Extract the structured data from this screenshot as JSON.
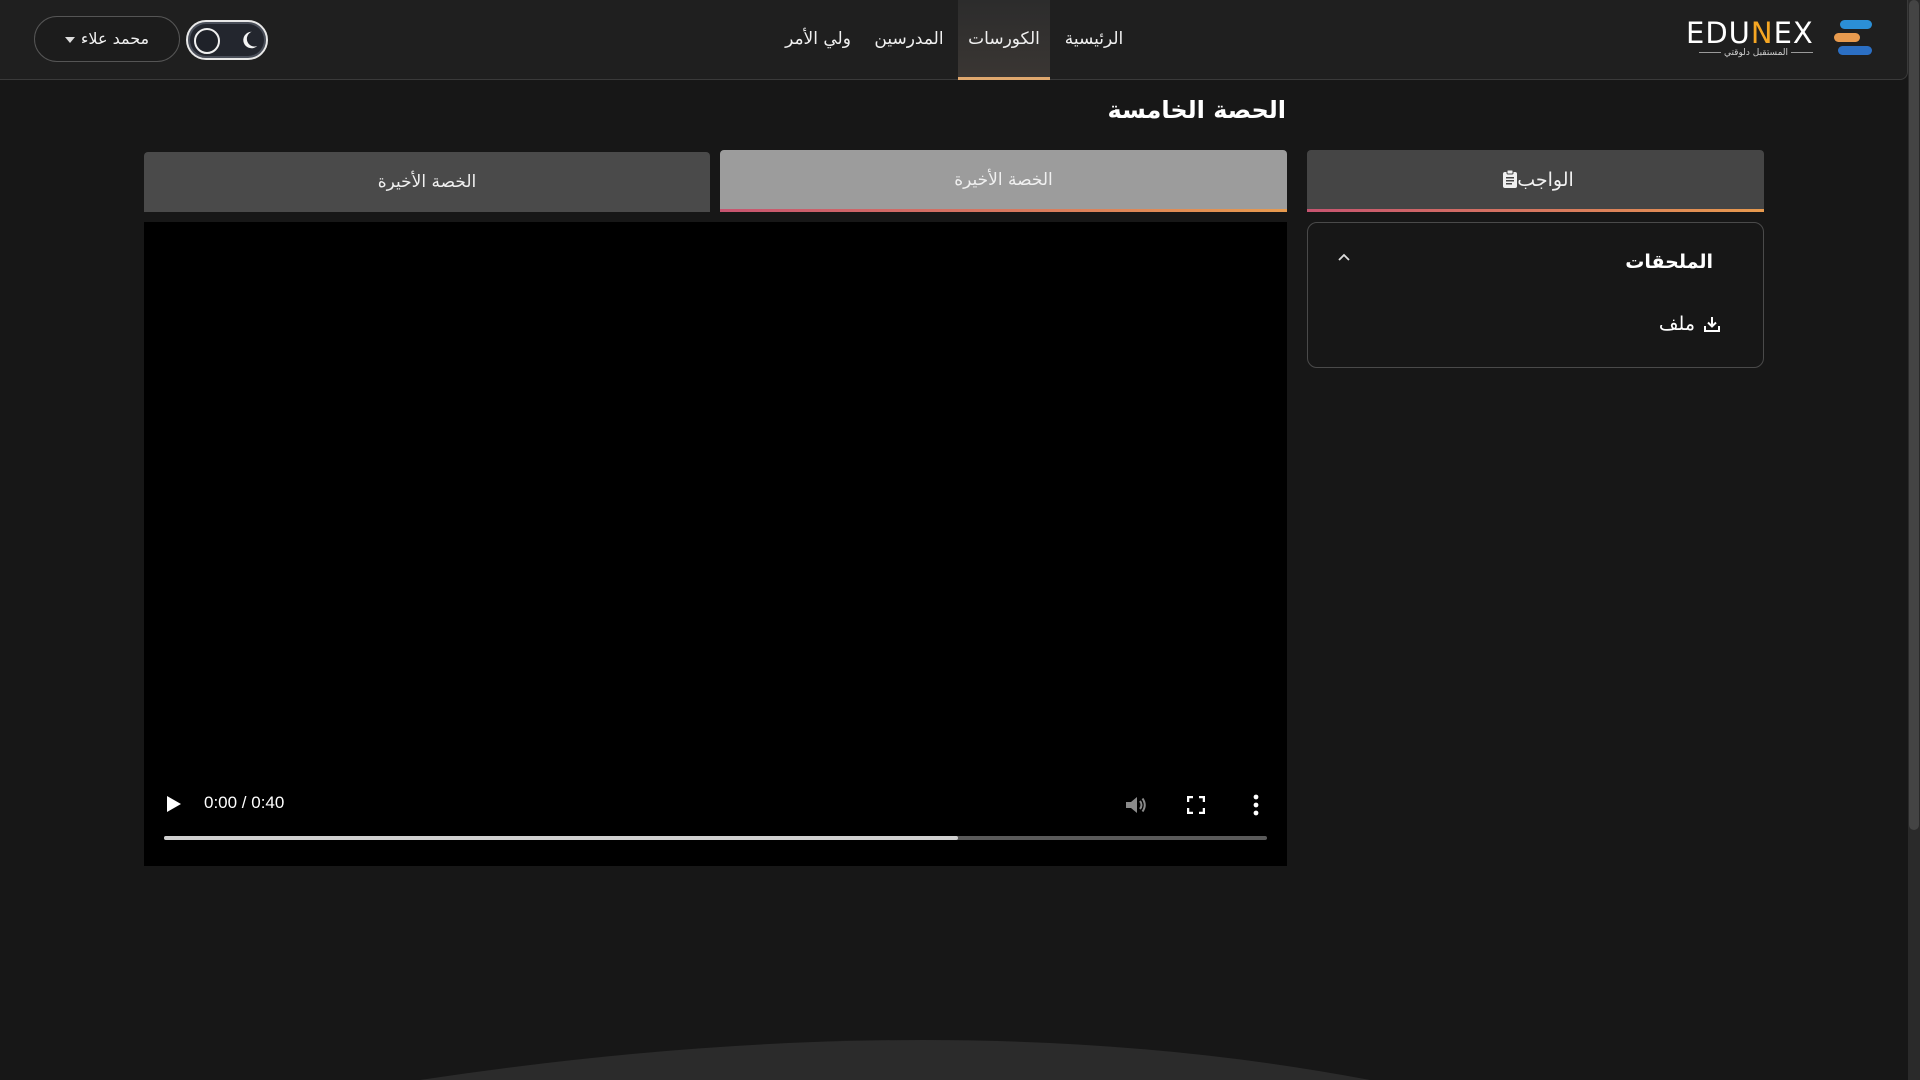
{
  "header": {
    "logo": {
      "text_main": "EDU",
      "text_accent": "N",
      "text_end": "EX",
      "tagline": "المستقبل دلوقتي"
    },
    "nav": [
      {
        "label": "الرئيسية",
        "active": false
      },
      {
        "label": "الكورسات",
        "active": true
      },
      {
        "label": "المدرسين",
        "active": false
      },
      {
        "label": "ولي الأمر",
        "active": false
      }
    ],
    "user_name": "محمد علاء",
    "theme_toggle_icon": "moon-icon"
  },
  "page": {
    "title": "الحصة الخامسة"
  },
  "tabs": [
    {
      "label": "الخصة الأخيرة",
      "active": false
    },
    {
      "label": "الخصة الأخيرة",
      "active": true
    },
    {
      "label": "الواجب",
      "icon": "clipboard-icon"
    }
  ],
  "video": {
    "time": "0:00 / 0:40",
    "progress_fraction": 0.72,
    "controls": [
      "play-icon",
      "volume-icon",
      "fullscreen-icon",
      "more-icon"
    ]
  },
  "attachments": {
    "title": "الملحقات",
    "file_label": "ملف",
    "file_icon": "download-icon"
  },
  "colors": {
    "background": "#171717",
    "header": "#1f1f1f",
    "accent_orange": "#e79a4e",
    "accent_pink": "#c75470",
    "logo_blue": "#2b8fd6"
  }
}
